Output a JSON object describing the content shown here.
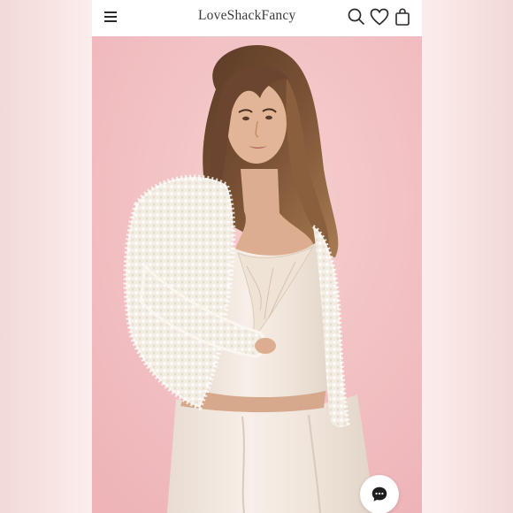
{
  "header": {
    "brand": "LoveShackFancy",
    "icons": [
      "menu-icon",
      "search-icon",
      "heart-icon",
      "bag-icon"
    ]
  },
  "hero": {
    "description_image": "product-model-photo"
  },
  "chat": {
    "icon": "chat-bubble-icon"
  },
  "colors": {
    "page_background": "#fbeeed",
    "photo_background": "#f3c3c5",
    "header_background": "#ffffff",
    "icon": "#2a2a2a"
  }
}
